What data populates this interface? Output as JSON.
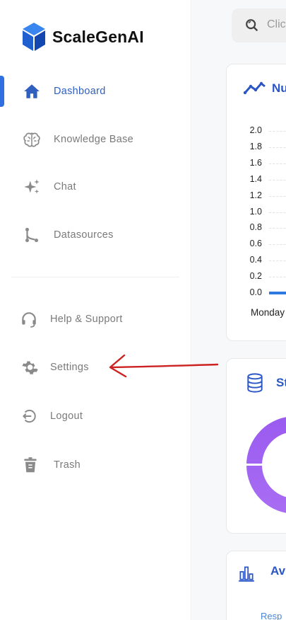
{
  "brand": {
    "name": "ScaleGenAI",
    "accent": "#2f6fe0"
  },
  "sidebar": {
    "items": [
      {
        "label": "Dashboard",
        "icon": "home-icon",
        "active": true
      },
      {
        "label": "Knowledge Base",
        "icon": "brain-icon",
        "active": false
      },
      {
        "label": "Chat",
        "icon": "sparkle-icon",
        "active": false
      },
      {
        "label": "Datasources",
        "icon": "branch-icon",
        "active": false
      }
    ],
    "footer_items": [
      {
        "label": "Help & Support",
        "icon": "headset-icon"
      },
      {
        "label": "Settings",
        "icon": "gear-icon"
      },
      {
        "label": "Logout",
        "icon": "logout-icon"
      },
      {
        "label": "Trash",
        "icon": "trash-icon"
      }
    ]
  },
  "search": {
    "placeholder": "Clic"
  },
  "cards": {
    "chart_title": "Nu",
    "storage_title": "St",
    "analytics_title": "Av",
    "analytics_sublabel": "Resp"
  },
  "chart_data": {
    "type": "bar",
    "title": "Nu",
    "categories": [
      "Monday"
    ],
    "values": [
      0.0
    ],
    "yticks": [
      "2.0",
      "1.8",
      "1.6",
      "1.4",
      "1.2",
      "1.0",
      "0.8",
      "0.6",
      "0.4",
      "0.2",
      "0.0"
    ],
    "ylim": [
      0,
      2.0
    ],
    "grid": true,
    "bar_color": "#2f7ae0"
  },
  "donut": {
    "color": "#9b5cf0"
  }
}
